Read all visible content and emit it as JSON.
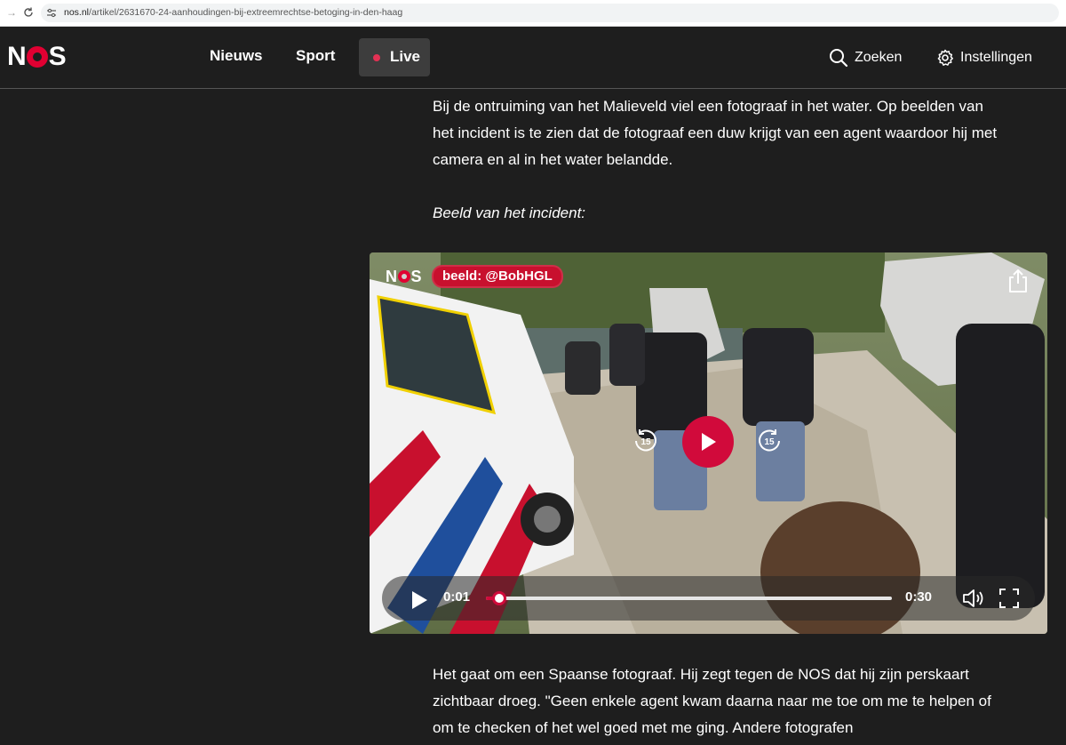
{
  "browser": {
    "url_host": "nos.nl",
    "url_path": "/artikel/2631670-24-aanhoudingen-bij-extreemrechtse-betoging-in-den-haag"
  },
  "header": {
    "logo_n": "N",
    "logo_s": "S",
    "nav": [
      "Nieuws",
      "Sport",
      "Live"
    ],
    "search_label": "Zoeken",
    "settings_label": "Instellingen",
    "accent": "#e10032"
  },
  "article": {
    "p1": "Bij de ontruiming van het Malieveld viel een fotograaf in het water. Op beelden van het incident is te zien dat de fotograaf een duw krijgt van een agent waardoor hij met camera en al in het water belandde.",
    "p2": "Beeld van het incident:",
    "p3": "Het gaat om een Spaanse fotograaf. Hij zegt tegen de NOS dat hij zijn perskaart zichtbaar droeg. \"Geen enkele agent kwam daarna naar me toe om me te helpen of om te checken of het wel goed met me ging. Andere fotografen"
  },
  "video": {
    "watermark_n": "N",
    "watermark_s": "S",
    "credit": "beeld: @BobHGL",
    "rewind_label": "15",
    "forward_label": "15",
    "time_current": "0:01",
    "time_total": "0:30",
    "progress": 0.033
  }
}
